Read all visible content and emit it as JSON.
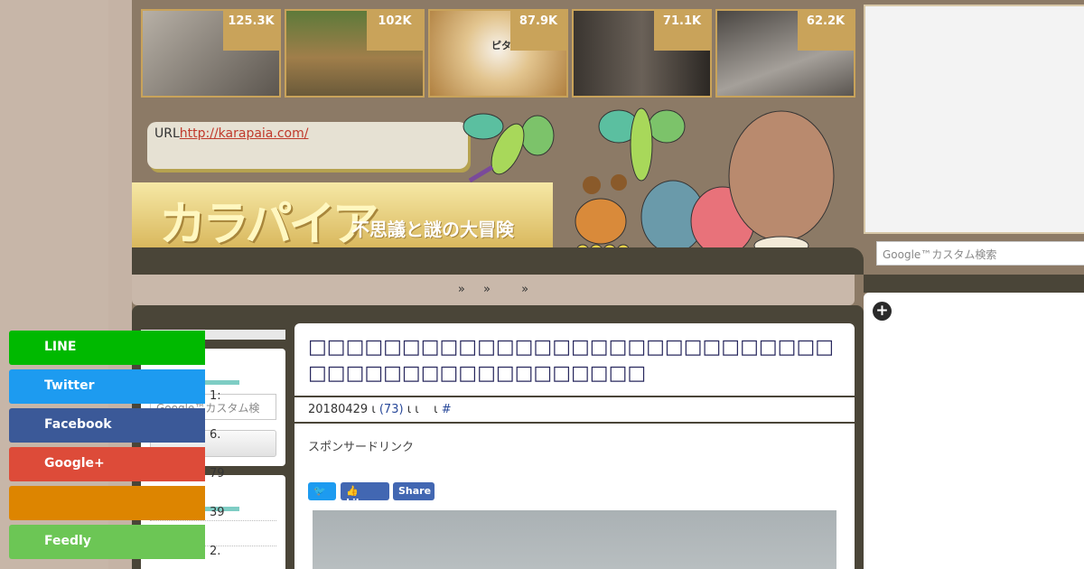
{
  "thumbnails": [
    {
      "count": "125.3K",
      "color": "#8e8880"
    },
    {
      "count": "102K",
      "color": "#7c6a46"
    },
    {
      "count": "87.9K",
      "color": "#d8b070"
    },
    {
      "count": "71.1K",
      "color": "#5a5048"
    },
    {
      "count": "62.2K",
      "color": "#6f6a66"
    }
  ],
  "thumb_caption_3": "ピタ～",
  "url_label": "URL",
  "url_link": "http://karapaia.com/",
  "logo": {
    "title": "カラパイア",
    "subtitle": "不思議と謎の大冒険"
  },
  "nav": {
    "sep1": "»",
    "sep2": "»",
    "sep3": "»"
  },
  "sidebar": {
    "search_placeholder": "Google™カスタム検索"
  },
  "article": {
    "title": "□□□□□□□□□□□□□□□□□□□□□□□□□□□□□□□□□□□□□□□□□□□□□□",
    "date": "20180429",
    "marker1": "ι",
    "comments": "(73)",
    "marker2": "ι ι",
    "marker3": "ι",
    "hash": "#",
    "sponsor": "スポンサードリンク",
    "tweet_label": "🐦",
    "like_label": "👍 Like",
    "share_label": "Share"
  },
  "right": {
    "search_placeholder": "Google™カスタム検索",
    "plus": "+",
    "share_rows": [
      {
        "label": "LINE",
        "count": "",
        "color": "#00b900"
      },
      {
        "label": "Twitter",
        "count": "1:",
        "color": "#1d9bf0"
      },
      {
        "label": "Facebook",
        "count": "6.",
        "color": "#3b5998"
      },
      {
        "label": "Google+",
        "count": "79",
        "color": "#dd4b39"
      },
      {
        "label": "",
        "count": "39",
        "color": "#dd8500"
      },
      {
        "label": "Feedly",
        "count": "2.",
        "color": "#6cc655"
      }
    ]
  }
}
